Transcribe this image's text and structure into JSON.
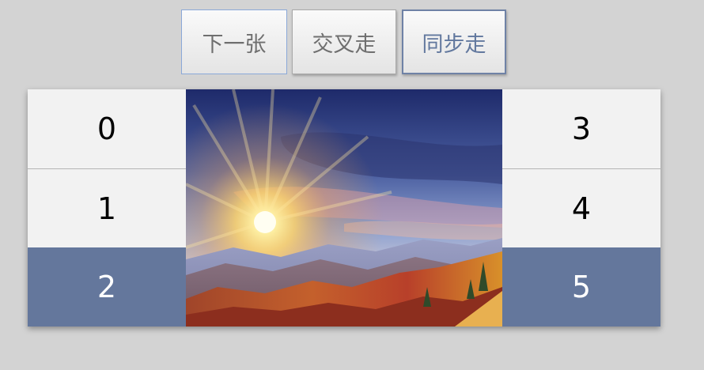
{
  "toolbar": {
    "next_label": "下一张",
    "cross_label": "交叉走",
    "sync_label": "同步走"
  },
  "thumbs": {
    "left": [
      {
        "label": "0",
        "active": false
      },
      {
        "label": "1",
        "active": false
      },
      {
        "label": "2",
        "active": true
      }
    ],
    "right": [
      {
        "label": "3",
        "active": false
      },
      {
        "label": "4",
        "active": false
      },
      {
        "label": "5",
        "active": true
      }
    ]
  },
  "colors": {
    "active_cell": "#64779c",
    "cell_bg": "#f2f2f2",
    "page_bg": "#d3d3d3",
    "sync_border": "#6f82a6"
  },
  "photo": {
    "subject": "sunrise-over-autumn-mountains"
  }
}
